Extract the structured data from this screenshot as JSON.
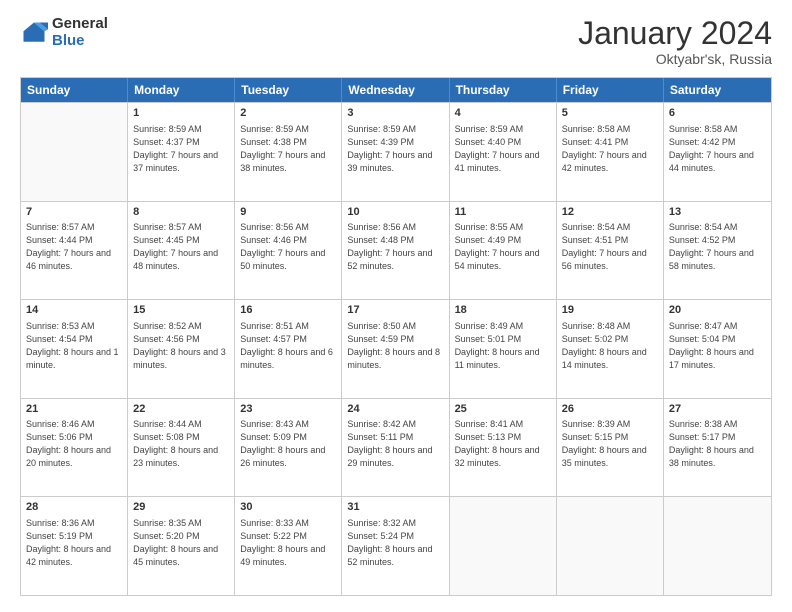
{
  "logo": {
    "general": "General",
    "blue": "Blue"
  },
  "title": {
    "month": "January 2024",
    "location": "Oktyabr'sk, Russia"
  },
  "header_days": [
    "Sunday",
    "Monday",
    "Tuesday",
    "Wednesday",
    "Thursday",
    "Friday",
    "Saturday"
  ],
  "weeks": [
    [
      {
        "day": "",
        "sunrise": "",
        "sunset": "",
        "daylight": ""
      },
      {
        "day": "1",
        "sunrise": "Sunrise: 8:59 AM",
        "sunset": "Sunset: 4:37 PM",
        "daylight": "Daylight: 7 hours and 37 minutes."
      },
      {
        "day": "2",
        "sunrise": "Sunrise: 8:59 AM",
        "sunset": "Sunset: 4:38 PM",
        "daylight": "Daylight: 7 hours and 38 minutes."
      },
      {
        "day": "3",
        "sunrise": "Sunrise: 8:59 AM",
        "sunset": "Sunset: 4:39 PM",
        "daylight": "Daylight: 7 hours and 39 minutes."
      },
      {
        "day": "4",
        "sunrise": "Sunrise: 8:59 AM",
        "sunset": "Sunset: 4:40 PM",
        "daylight": "Daylight: 7 hours and 41 minutes."
      },
      {
        "day": "5",
        "sunrise": "Sunrise: 8:58 AM",
        "sunset": "Sunset: 4:41 PM",
        "daylight": "Daylight: 7 hours and 42 minutes."
      },
      {
        "day": "6",
        "sunrise": "Sunrise: 8:58 AM",
        "sunset": "Sunset: 4:42 PM",
        "daylight": "Daylight: 7 hours and 44 minutes."
      }
    ],
    [
      {
        "day": "7",
        "sunrise": "Sunrise: 8:57 AM",
        "sunset": "Sunset: 4:44 PM",
        "daylight": "Daylight: 7 hours and 46 minutes."
      },
      {
        "day": "8",
        "sunrise": "Sunrise: 8:57 AM",
        "sunset": "Sunset: 4:45 PM",
        "daylight": "Daylight: 7 hours and 48 minutes."
      },
      {
        "day": "9",
        "sunrise": "Sunrise: 8:56 AM",
        "sunset": "Sunset: 4:46 PM",
        "daylight": "Daylight: 7 hours and 50 minutes."
      },
      {
        "day": "10",
        "sunrise": "Sunrise: 8:56 AM",
        "sunset": "Sunset: 4:48 PM",
        "daylight": "Daylight: 7 hours and 52 minutes."
      },
      {
        "day": "11",
        "sunrise": "Sunrise: 8:55 AM",
        "sunset": "Sunset: 4:49 PM",
        "daylight": "Daylight: 7 hours and 54 minutes."
      },
      {
        "day": "12",
        "sunrise": "Sunrise: 8:54 AM",
        "sunset": "Sunset: 4:51 PM",
        "daylight": "Daylight: 7 hours and 56 minutes."
      },
      {
        "day": "13",
        "sunrise": "Sunrise: 8:54 AM",
        "sunset": "Sunset: 4:52 PM",
        "daylight": "Daylight: 7 hours and 58 minutes."
      }
    ],
    [
      {
        "day": "14",
        "sunrise": "Sunrise: 8:53 AM",
        "sunset": "Sunset: 4:54 PM",
        "daylight": "Daylight: 8 hours and 1 minute."
      },
      {
        "day": "15",
        "sunrise": "Sunrise: 8:52 AM",
        "sunset": "Sunset: 4:56 PM",
        "daylight": "Daylight: 8 hours and 3 minutes."
      },
      {
        "day": "16",
        "sunrise": "Sunrise: 8:51 AM",
        "sunset": "Sunset: 4:57 PM",
        "daylight": "Daylight: 8 hours and 6 minutes."
      },
      {
        "day": "17",
        "sunrise": "Sunrise: 8:50 AM",
        "sunset": "Sunset: 4:59 PM",
        "daylight": "Daylight: 8 hours and 8 minutes."
      },
      {
        "day": "18",
        "sunrise": "Sunrise: 8:49 AM",
        "sunset": "Sunset: 5:01 PM",
        "daylight": "Daylight: 8 hours and 11 minutes."
      },
      {
        "day": "19",
        "sunrise": "Sunrise: 8:48 AM",
        "sunset": "Sunset: 5:02 PM",
        "daylight": "Daylight: 8 hours and 14 minutes."
      },
      {
        "day": "20",
        "sunrise": "Sunrise: 8:47 AM",
        "sunset": "Sunset: 5:04 PM",
        "daylight": "Daylight: 8 hours and 17 minutes."
      }
    ],
    [
      {
        "day": "21",
        "sunrise": "Sunrise: 8:46 AM",
        "sunset": "Sunset: 5:06 PM",
        "daylight": "Daylight: 8 hours and 20 minutes."
      },
      {
        "day": "22",
        "sunrise": "Sunrise: 8:44 AM",
        "sunset": "Sunset: 5:08 PM",
        "daylight": "Daylight: 8 hours and 23 minutes."
      },
      {
        "day": "23",
        "sunrise": "Sunrise: 8:43 AM",
        "sunset": "Sunset: 5:09 PM",
        "daylight": "Daylight: 8 hours and 26 minutes."
      },
      {
        "day": "24",
        "sunrise": "Sunrise: 8:42 AM",
        "sunset": "Sunset: 5:11 PM",
        "daylight": "Daylight: 8 hours and 29 minutes."
      },
      {
        "day": "25",
        "sunrise": "Sunrise: 8:41 AM",
        "sunset": "Sunset: 5:13 PM",
        "daylight": "Daylight: 8 hours and 32 minutes."
      },
      {
        "day": "26",
        "sunrise": "Sunrise: 8:39 AM",
        "sunset": "Sunset: 5:15 PM",
        "daylight": "Daylight: 8 hours and 35 minutes."
      },
      {
        "day": "27",
        "sunrise": "Sunrise: 8:38 AM",
        "sunset": "Sunset: 5:17 PM",
        "daylight": "Daylight: 8 hours and 38 minutes."
      }
    ],
    [
      {
        "day": "28",
        "sunrise": "Sunrise: 8:36 AM",
        "sunset": "Sunset: 5:19 PM",
        "daylight": "Daylight: 8 hours and 42 minutes."
      },
      {
        "day": "29",
        "sunrise": "Sunrise: 8:35 AM",
        "sunset": "Sunset: 5:20 PM",
        "daylight": "Daylight: 8 hours and 45 minutes."
      },
      {
        "day": "30",
        "sunrise": "Sunrise: 8:33 AM",
        "sunset": "Sunset: 5:22 PM",
        "daylight": "Daylight: 8 hours and 49 minutes."
      },
      {
        "day": "31",
        "sunrise": "Sunrise: 8:32 AM",
        "sunset": "Sunset: 5:24 PM",
        "daylight": "Daylight: 8 hours and 52 minutes."
      },
      {
        "day": "",
        "sunrise": "",
        "sunset": "",
        "daylight": ""
      },
      {
        "day": "",
        "sunrise": "",
        "sunset": "",
        "daylight": ""
      },
      {
        "day": "",
        "sunrise": "",
        "sunset": "",
        "daylight": ""
      }
    ]
  ]
}
